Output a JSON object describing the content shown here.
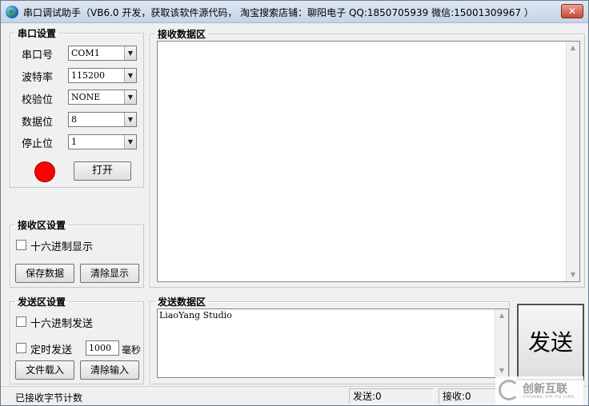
{
  "window": {
    "title": "串口调试助手（VB6.0 开发，获取该软件源代码， 淘宝搜索店铺：聊阳电子 QQ:1850705939 微信:15001309967 ）",
    "close_label": "✕"
  },
  "serial": {
    "legend": "串口设置",
    "port_label": "串口号",
    "port_value": "COM1",
    "baud_label": "波特率",
    "baud_value": "115200",
    "parity_label": "校验位",
    "parity_value": "NONE",
    "databits_label": "数据位",
    "databits_value": "8",
    "stopbits_label": "停止位",
    "stopbits_value": "1",
    "open_label": "打开"
  },
  "receive_settings": {
    "legend": "接收区设置",
    "hex_display_label": "十六进制显示",
    "save_label": "保存数据",
    "clear_label": "清除显示"
  },
  "send_settings": {
    "legend": "发送区设置",
    "hex_send_label": "十六进制发送",
    "timed_send_label": "定时发送",
    "interval_value": "1000",
    "interval_unit": "毫秒",
    "load_file_label": "文件载入",
    "clear_input_label": "清除输入"
  },
  "receive_area": {
    "legend": "接收数据区",
    "content": ""
  },
  "send_area": {
    "legend": "发送数据区",
    "content": "LiaoYang Studio",
    "send_button": "发送"
  },
  "status": {
    "received_bytes": "已接收字节计数",
    "sent": "发送:0",
    "received": "接收:0"
  },
  "watermark": {
    "name": "创新互联",
    "sub": "CHUANG XIN HU LIAN"
  },
  "colors": {
    "led": "#ff0000",
    "window_bg": "#f0f0f0"
  }
}
